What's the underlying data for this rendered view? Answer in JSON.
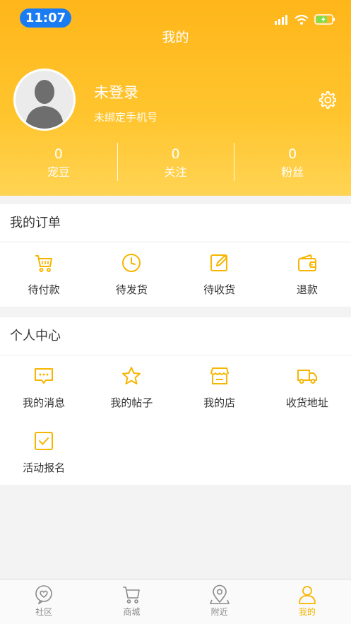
{
  "status_bar": {
    "time": "11:07"
  },
  "nav": {
    "title": "我的"
  },
  "profile": {
    "name": "未登录",
    "phone": "未绑定手机号"
  },
  "stats": [
    {
      "value": "0",
      "label": "宠豆"
    },
    {
      "value": "0",
      "label": "关注"
    },
    {
      "value": "0",
      "label": "粉丝"
    }
  ],
  "orders": {
    "title": "我的订单",
    "items": [
      {
        "label": "待付款",
        "icon": "cart-icon"
      },
      {
        "label": "待发货",
        "icon": "clock-icon"
      },
      {
        "label": "待收货",
        "icon": "edit-icon"
      },
      {
        "label": "退款",
        "icon": "wallet-icon"
      }
    ]
  },
  "center": {
    "title": "个人中心",
    "items": [
      {
        "label": "我的消息",
        "icon": "message-icon"
      },
      {
        "label": "我的帖子",
        "icon": "star-icon"
      },
      {
        "label": "我的店",
        "icon": "store-icon"
      },
      {
        "label": "收货地址",
        "icon": "truck-icon"
      },
      {
        "label": "活动报名",
        "icon": "checkbox-icon"
      }
    ]
  },
  "tabbar": [
    {
      "label": "社区",
      "icon": "community-icon"
    },
    {
      "label": "商城",
      "icon": "cart-icon"
    },
    {
      "label": "附近",
      "icon": "location-icon"
    },
    {
      "label": "我的",
      "icon": "person-icon",
      "active": true
    }
  ],
  "colors": {
    "accent": "#f7b500",
    "header": "#ffc52e",
    "time_pill": "#1a7cf2"
  }
}
